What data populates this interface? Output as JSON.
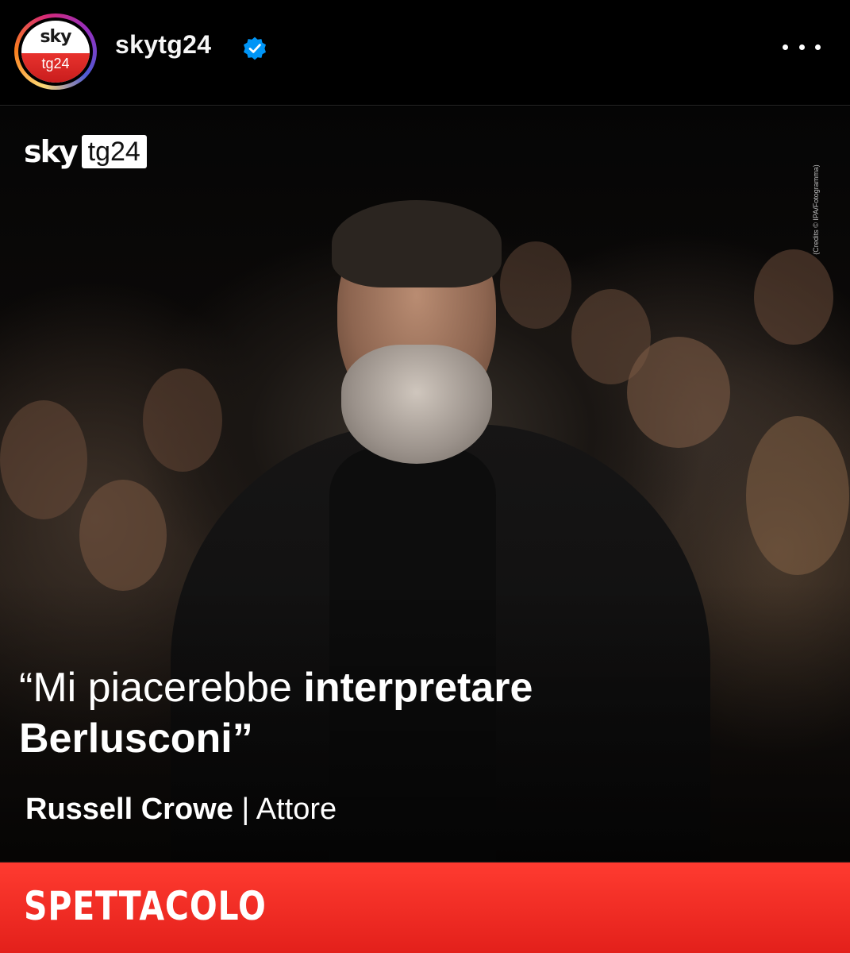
{
  "header": {
    "avatar": {
      "brand_top": "sky",
      "brand_bottom": "tg24"
    },
    "username": "skytg24",
    "verified_icon": "verified-badge-icon",
    "more_icon": "more-horizontal-icon"
  },
  "post": {
    "logo": {
      "sky": "sky",
      "tg": "tg24"
    },
    "credits": "(Credits © IPA/Fotogramma)",
    "quote": {
      "open": "“Mi piacerebbe ",
      "bold": "interpretare",
      "line2": "Berlusconi”"
    },
    "byline": {
      "name": "Russell Crowe",
      "separator": " | ",
      "role": "Attore"
    },
    "category": "SPETTACOLO"
  },
  "colors": {
    "category_red": "#e3201b",
    "verified_blue": "#0095f6"
  }
}
